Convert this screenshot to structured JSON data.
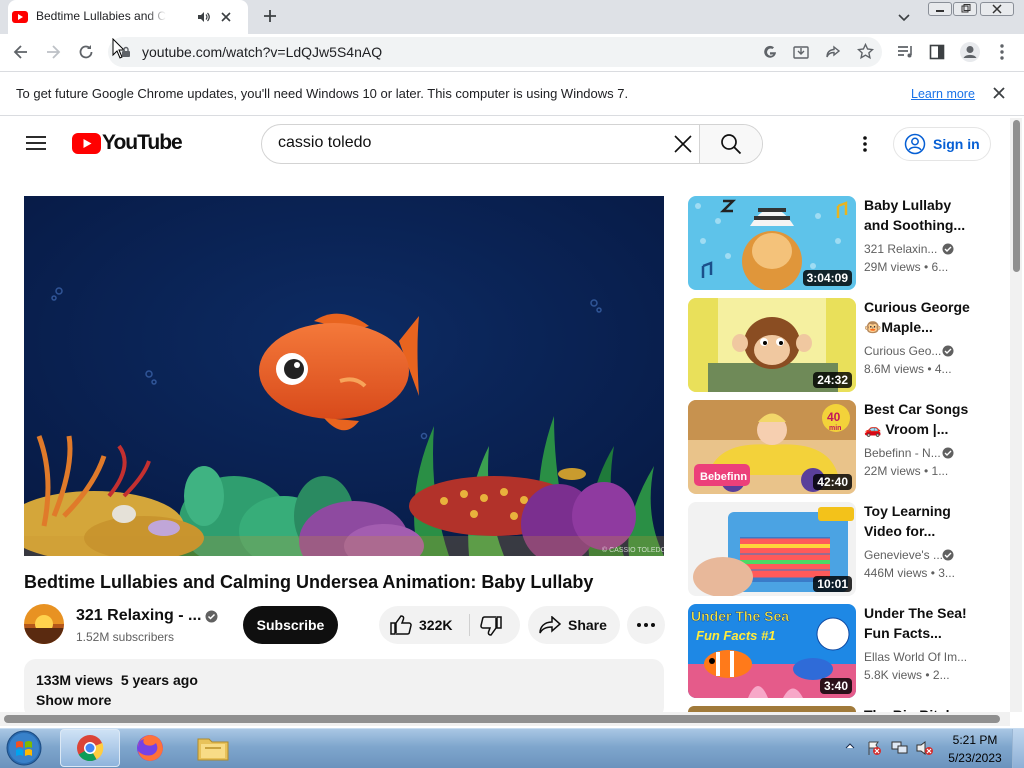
{
  "browser": {
    "tab_title": "Bedtime Lullabies and Calming Undersea Animation",
    "url": "youtube.com/watch?v=LdQJw5S4nAQ",
    "infobar_text": "To get future Google Chrome updates, you'll need Windows 10 or later. This computer is using Windows 7.",
    "infobar_link": "Learn more"
  },
  "youtube": {
    "logo_text": "YouTube",
    "search_query": "cassio toledo",
    "sign_in": "Sign in"
  },
  "video": {
    "title": "Bedtime Lullabies and Calming Undersea Animation: Baby Lullaby",
    "channel": "321 Relaxing - ...",
    "subscribers": "1.52M subscribers",
    "subscribe": "Subscribe",
    "likes": "322K",
    "share": "Share",
    "watermark": "© CASSIO TOLEDO",
    "stats": "133M views  5 years ago",
    "show_more": "Show more"
  },
  "suggestions": [
    {
      "title": "Baby Lullaby and Soothing...",
      "channel": "321 Relaxin...",
      "meta": "29M views  • 6...",
      "duration": "3:04:09"
    },
    {
      "title": "Curious George 🐵Maple...",
      "channel": "Curious Geo...",
      "meta": "8.6M views  • 4...",
      "duration": "24:32"
    },
    {
      "title": "Best Car Songs 🚗 Vroom |...",
      "channel": "Bebefinn - N...",
      "meta": "22M views  • 1...",
      "duration": "42:40"
    },
    {
      "title": "Toy Learning Video for...",
      "channel": "Genevieve's ...",
      "meta": "446M views  • 3...",
      "duration": "10:01"
    },
    {
      "title": "Under The Sea! Fun Facts...",
      "channel": "Ellas World Of Im...",
      "meta": "5.8K views  • 2...",
      "duration": "3:40"
    },
    {
      "title": "The Big Bitch...",
      "channel": "",
      "meta": "",
      "duration": ""
    }
  ],
  "thumb_text": {
    "bebefinn": "Bebefinn",
    "forty": "40",
    "min": "min",
    "under_sea": "Under The Sea",
    "fun_facts": "Fun Facts #1"
  },
  "taskbar": {
    "time": "5:21 PM",
    "date": "5/23/2023"
  },
  "colors": {
    "youtube_red": "#ff0000",
    "link_blue": "#065fd4",
    "chrome_blue": "#1a73e8"
  }
}
